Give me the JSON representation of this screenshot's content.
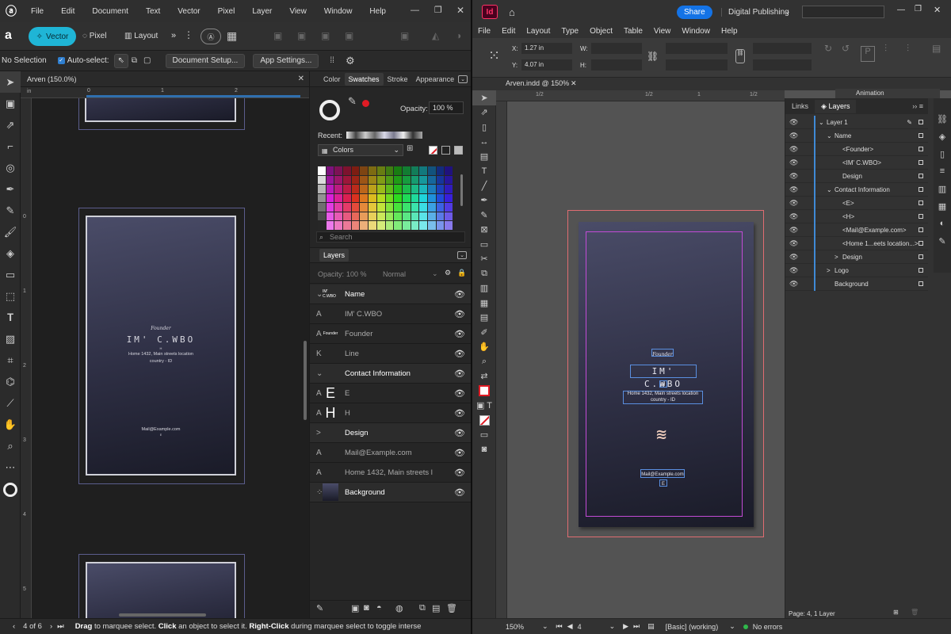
{
  "affinity": {
    "menu": [
      "File",
      "Edit",
      "Document",
      "Text",
      "Vector",
      "Pixel",
      "Layer",
      "View",
      "Window",
      "Help"
    ],
    "personas": {
      "vector": "Vector",
      "pixel": "Pixel",
      "layout": "Layout",
      "more": "»"
    },
    "context": {
      "selection": "No Selection",
      "autoselect": "Auto-select:",
      "doc_setup": "Document Setup...",
      "app_settings": "App Settings..."
    },
    "doc_tab": "Arven (150.0%)",
    "ruler_unit": "in",
    "hruler_ticks": [
      "0",
      "1",
      "2"
    ],
    "vruler_ticks": [
      "0",
      "1",
      "2",
      "3",
      "4",
      "5"
    ],
    "card": {
      "founder": "Founder",
      "name": "IM' C.WBO",
      "line_h": "H",
      "address1": "Home 1432, Main streets location",
      "address2": "country - ID",
      "mail": "Mail@Example.com",
      "mail_e": "E"
    },
    "panel_tabs": [
      "Color",
      "Swatches",
      "Stroke",
      "Appearance"
    ],
    "opacity_label": "Opacity:",
    "opacity_value": "100 %",
    "recent_label": "Recent:",
    "palette": "Colors",
    "search_placeholder": "Search",
    "layers_tab": "Layers",
    "layers_opacity_label": "Opacity:",
    "layers_opacity": "100 %",
    "blend_mode": "Normal",
    "layers": [
      {
        "label": "Name",
        "icon": "⌄",
        "thumb": "IM' C.WBO",
        "group": true
      },
      {
        "label": "IM' C.WBO",
        "icon": "A",
        "thumb": ""
      },
      {
        "label": "Founder",
        "icon": "A",
        "thumb": "Founder"
      },
      {
        "label": "Line",
        "icon": "K",
        "thumb": ""
      },
      {
        "label": "Contact Information",
        "icon": "⌄",
        "thumb": "",
        "group": true
      },
      {
        "label": "E",
        "icon": "A",
        "thumb": "E"
      },
      {
        "label": "H",
        "icon": "A",
        "thumb": "H"
      },
      {
        "label": "Design",
        "icon": ">",
        "thumb": "",
        "group": true
      },
      {
        "label": "Mail@Example.com",
        "icon": "A",
        "thumb": ""
      },
      {
        "label": "Home 1432, Main streets l",
        "icon": "A",
        "thumb": ""
      },
      {
        "label": "Background",
        "icon": "⁘",
        "thumb": "",
        "group": true
      }
    ],
    "status": {
      "page": "4 of 6",
      "hint_bold1": "Drag",
      "hint1": " to marquee select. ",
      "hint_bold2": "Click",
      "hint2": " an object to select it. ",
      "hint_bold3": "Right-Click",
      "hint3": " during marquee select to toggle interse"
    }
  },
  "indesign": {
    "share": "Share",
    "workspace": "Digital Publishing",
    "menu": [
      "File",
      "Edit",
      "Layout",
      "Type",
      "Object",
      "Table",
      "View",
      "Window",
      "Help"
    ],
    "x_label": "X:",
    "x_value": "1.27 in",
    "y_label": "Y:",
    "y_value": "4.07 in",
    "w_label": "W:",
    "h_label": "H:",
    "doc_tab": "Arven.indd @ 150%",
    "ruler_ticks": [
      "1/2",
      "1/2",
      "1",
      "1/2"
    ],
    "panel_tabs": [
      "Links",
      "Layers"
    ],
    "animation_tab": "Animation",
    "layers": [
      {
        "label": "Layer 1",
        "indent": 0,
        "arrow": "⌄"
      },
      {
        "label": "Name",
        "indent": 1,
        "arrow": "⌄"
      },
      {
        "label": "<Founder>",
        "indent": 2,
        "arrow": ""
      },
      {
        "label": "<IM' C.WBO>",
        "indent": 2,
        "arrow": ""
      },
      {
        "label": "Design",
        "indent": 2,
        "arrow": ""
      },
      {
        "label": "Contact Information",
        "indent": 1,
        "arrow": "⌄"
      },
      {
        "label": "<E>",
        "indent": 2,
        "arrow": ""
      },
      {
        "label": "<H>",
        "indent": 2,
        "arrow": ""
      },
      {
        "label": "<Mail@Example.com>",
        "indent": 2,
        "arrow": ""
      },
      {
        "label": "<Home 1...eets location...>",
        "indent": 2,
        "arrow": ""
      },
      {
        "label": "Design",
        "indent": 2,
        "arrow": ">"
      },
      {
        "label": "Logo",
        "indent": 1,
        "arrow": ">"
      },
      {
        "label": "Background",
        "indent": 1,
        "arrow": ""
      }
    ],
    "panel_footer": "Page: 4, 1 Layer",
    "card": {
      "founder": "Founder",
      "name": "IM' C.WBO",
      "line_h": "H",
      "address1": "Home 1432, Main streets location",
      "address2": "country - ID",
      "mail": "Mail@Example.com",
      "mail_e": "E"
    },
    "status": {
      "zoom": "150%",
      "page": "4",
      "style": "[Basic] (working)",
      "errors": "No errors"
    }
  }
}
